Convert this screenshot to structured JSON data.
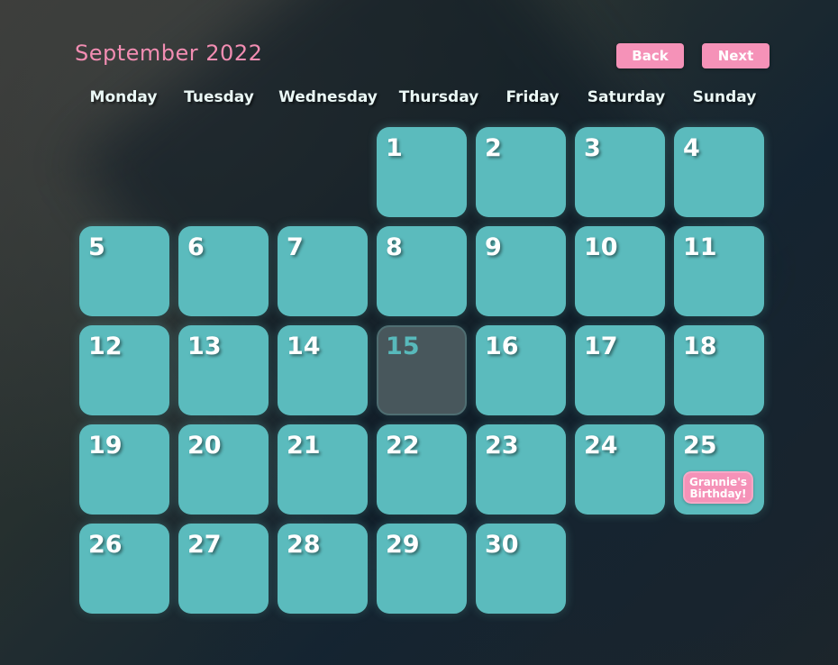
{
  "header": {
    "title": "September 2022",
    "back_label": "Back",
    "next_label": "Next"
  },
  "weekdays": [
    "Monday",
    "Tuesday",
    "Wednesday",
    "Thursday",
    "Friday",
    "Saturday",
    "Sunday"
  ],
  "calendar": {
    "first_weekday_index": 3,
    "days": [
      "1",
      "2",
      "3",
      "4",
      "5",
      "6",
      "7",
      "8",
      "9",
      "10",
      "11",
      "12",
      "13",
      "14",
      "15",
      "16",
      "17",
      "18",
      "19",
      "20",
      "21",
      "22",
      "23",
      "24",
      "25",
      "26",
      "27",
      "28",
      "29",
      "30"
    ],
    "today": "15",
    "events": [
      {
        "day": "25",
        "label": "Grannie's Birthday!"
      }
    ]
  },
  "colors": {
    "accent_pink": "#f592b8",
    "day_tile": "#5bbbbd",
    "today_tile": "#48575c"
  }
}
